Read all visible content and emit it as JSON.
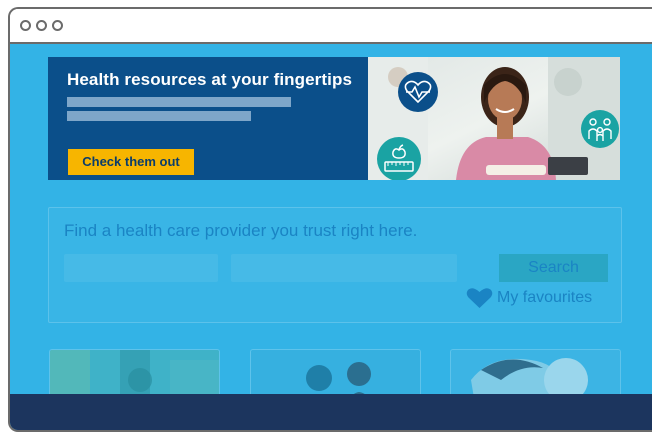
{
  "banner": {
    "title": "Health resources at your fingertips",
    "cta_label": "Check them out"
  },
  "search": {
    "heading": "Find a health care provider you trust right here.",
    "button_label": "Search",
    "favourites_label": "My favourites"
  },
  "colors": {
    "page_background": "#33b3e6",
    "banner_background": "#0b4f8a",
    "cta_background": "#f7b500",
    "footer_background": "#1c355e",
    "accent_text": "#1a84c4"
  },
  "icons": [
    "heart-monitor-icon",
    "apple-scale-icon",
    "family-icon",
    "heart-icon"
  ]
}
